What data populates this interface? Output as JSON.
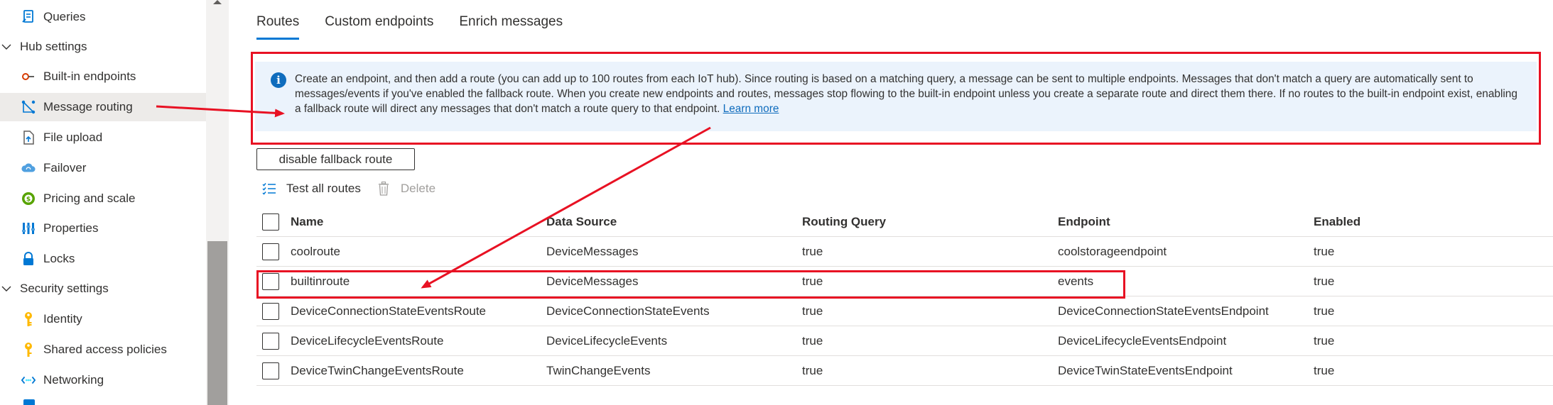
{
  "sidebar": {
    "items": [
      {
        "label": "Queries",
        "icon": "queries-icon"
      },
      {
        "label": "Built-in endpoints",
        "icon": "endpoint-icon"
      },
      {
        "label": "Message routing",
        "icon": "routing-icon",
        "active": true
      },
      {
        "label": "File upload",
        "icon": "file-upload-icon"
      },
      {
        "label": "Failover",
        "icon": "failover-icon"
      },
      {
        "label": "Pricing and scale",
        "icon": "pricing-icon"
      },
      {
        "label": "Properties",
        "icon": "properties-icon"
      },
      {
        "label": "Locks",
        "icon": "lock-icon"
      },
      {
        "label": "Identity",
        "icon": "identity-icon"
      },
      {
        "label": "Shared access policies",
        "icon": "key-icon"
      },
      {
        "label": "Networking",
        "icon": "networking-icon"
      }
    ],
    "groups": [
      {
        "label": "Hub settings"
      },
      {
        "label": "Security settings"
      }
    ]
  },
  "tabs": [
    {
      "label": "Routes",
      "active": true
    },
    {
      "label": "Custom endpoints"
    },
    {
      "label": "Enrich messages"
    }
  ],
  "info": {
    "text": "Create an endpoint, and then add a route (you can add up to 100 routes from each IoT hub). Since routing is based on a matching query, a message can be sent to multiple endpoints. Messages that don't match a query are automatically sent to messages/events if you've enabled the fallback route. When you create new endpoints and routes, messages stop flowing to the built-in endpoint unless you create a separate route and direct them there. If no routes to the built-in endpoint exist, enabling a fallback route will direct any messages that don't match a route query to that endpoint.",
    "link": "Learn more"
  },
  "fallback_button": "disable fallback route",
  "toolbar": {
    "test_all": "Test all routes",
    "delete": "Delete"
  },
  "table": {
    "columns": [
      "Name",
      "Data Source",
      "Routing Query",
      "Endpoint",
      "Enabled"
    ],
    "rows": [
      [
        "coolroute",
        "DeviceMessages",
        "true",
        "coolstorageendpoint",
        "true"
      ],
      [
        "builtinroute",
        "DeviceMessages",
        "true",
        "events",
        "true"
      ],
      [
        "DeviceConnectionStateEventsRoute",
        "DeviceConnectionStateEvents",
        "true",
        "DeviceConnectionStateEventsEndpoint",
        "true"
      ],
      [
        "DeviceLifecycleEventsRoute",
        "DeviceLifecycleEvents",
        "true",
        "DeviceLifecycleEventsEndpoint",
        "true"
      ],
      [
        "DeviceTwinChangeEventsRoute",
        "TwinChangeEvents",
        "true",
        "DeviceTwinStateEventsEndpoint",
        "true"
      ]
    ]
  },
  "colors": {
    "accent": "#0078d4",
    "annotation": "#e81123",
    "banner": "#ebf3fc"
  }
}
